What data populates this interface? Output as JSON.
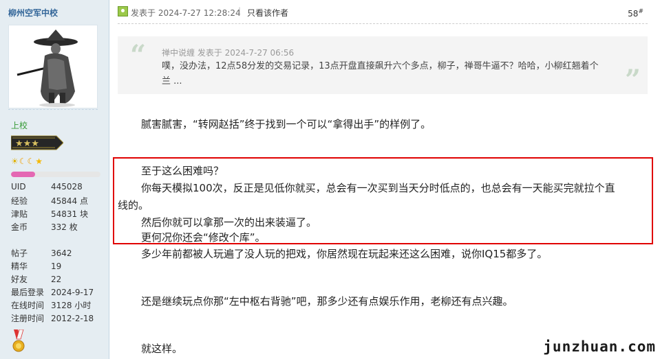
{
  "sidebar": {
    "username": "柳州空军中校",
    "rank": "上校",
    "level_icons": [
      "sun",
      "moon",
      "moon",
      "star"
    ],
    "progress_fraction": 0.27,
    "stats": [
      {
        "label": "UID",
        "value": "445028"
      },
      {
        "label": "经验",
        "value": "45844 点"
      },
      {
        "label": "津贴",
        "value": "54831 块"
      },
      {
        "label": "金币",
        "value": "332 枚"
      },
      {
        "label": "帖子",
        "value": "3642"
      },
      {
        "label": "精华",
        "value": "19"
      },
      {
        "label": "好友",
        "value": "22"
      },
      {
        "label": "最后登录",
        "value": "2024-9-17"
      },
      {
        "label": "在线时间",
        "value": "3128 小时"
      },
      {
        "label": "注册时间",
        "value": "2012-2-18"
      }
    ]
  },
  "post": {
    "posted_at": "发表于 2024-7-27 12:28:24",
    "divider": "|",
    "author_only": "只看该作者",
    "floor": "58",
    "floor_mark": "#"
  },
  "quote": {
    "meta": "禅中说缠 发表于 2024-7-27 06:56",
    "text": "噗，没办法，12点58分发的交易记录，13点开盘直接飙升六个多点，柳子，禅哥牛逼不？哈哈，小柳红翘着个兰 ..."
  },
  "body": {
    "p1": "腻害腻害，“转网赵括”终于找到一个可以“拿得出手”的样例了。",
    "p2_l1": "至于这么困难吗？",
    "p2_l2": "你每天模拟100次，反正是见低你就买，总会有一次买到当天分时低点的，也总会有一天能买完就拉个直",
    "p2_l3": "线的。",
    "p2_l4": "然后你就可以拿那一次的出来装逼了。",
    "p2_l5": "更何况你还会“修改个库”。",
    "p3": "多少年前都被人玩遍了没人玩的把戏，你居然现在玩起来还这么困难，说你IQ15都多了。",
    "p4": "还是继续玩点你那“左中枢右背驰”吧，那多少还有点娱乐作用，老柳还有点兴趣。",
    "p5": "就这样。"
  },
  "watermark": "junzhuan.com",
  "colors": {
    "sidebar_bg": "#e5edf2",
    "username": "#336699",
    "rank": "#339933",
    "progress": "#e468b3",
    "highlight_box": "#e00000",
    "quote_bg": "#f4f4f4"
  }
}
